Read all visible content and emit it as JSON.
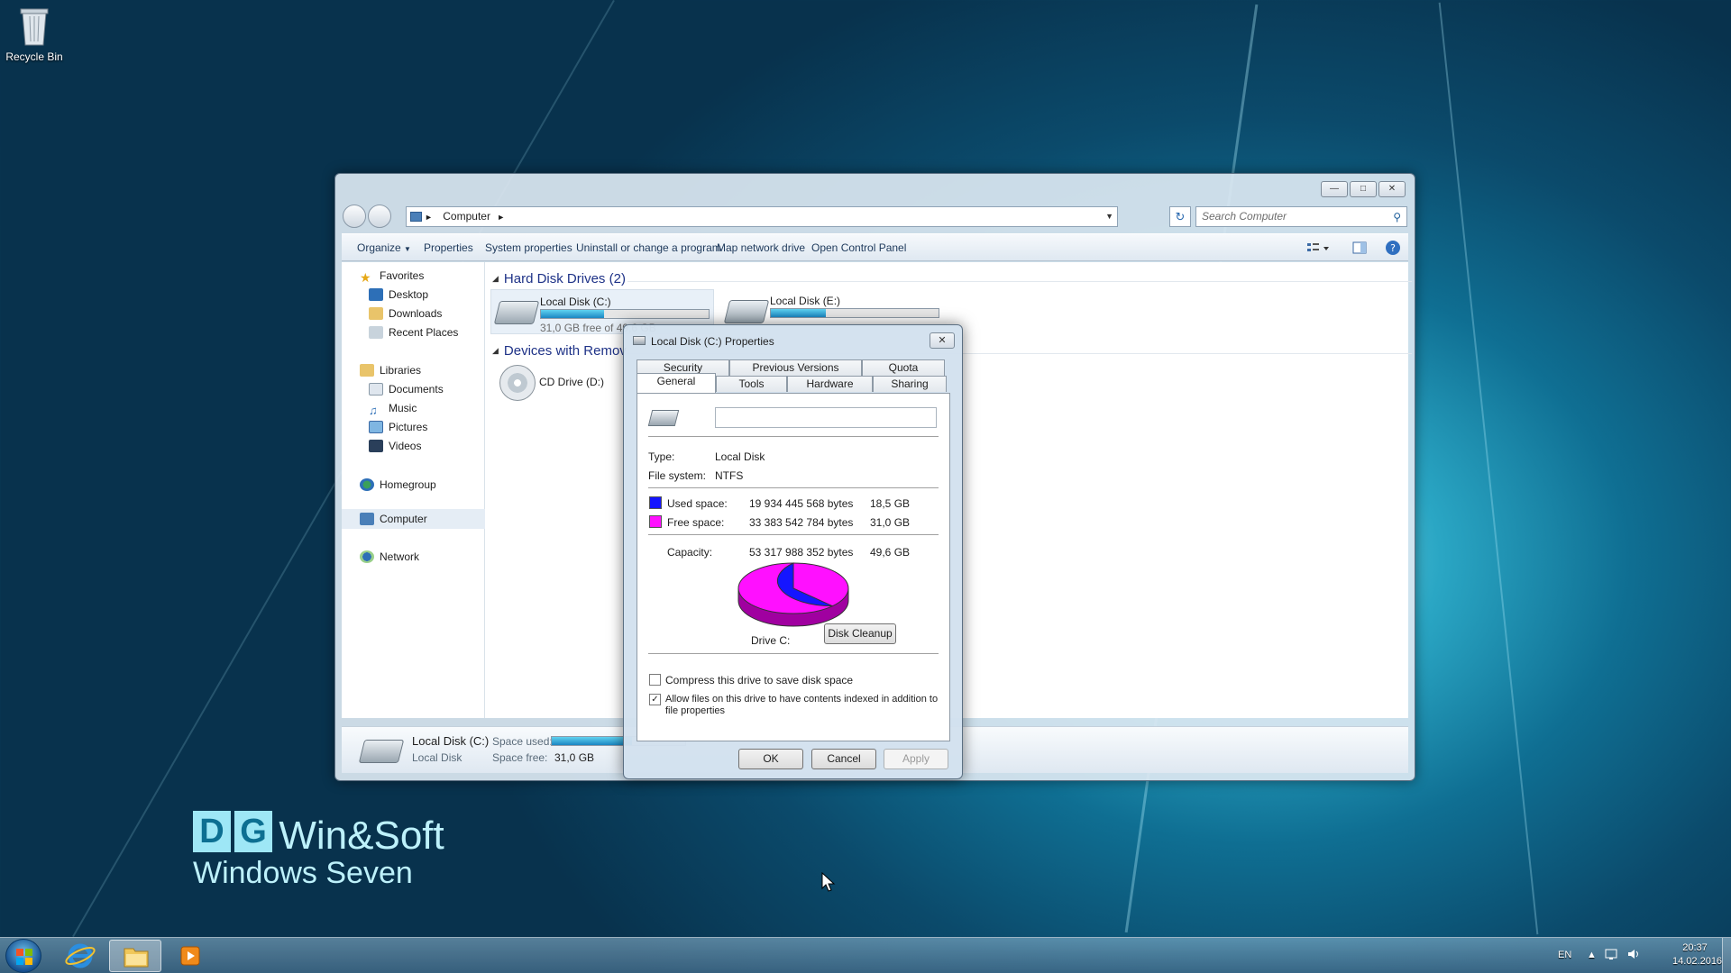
{
  "desktop": {
    "recycle_bin_label": "Recycle Bin",
    "branding": {
      "letters": [
        "D",
        "G"
      ],
      "name": "Win&Soft",
      "subtitle": "Windows Seven"
    }
  },
  "explorer": {
    "address": "Computer",
    "search_placeholder": "Search Computer",
    "toolbar": [
      "Organize",
      "Properties",
      "System properties",
      "Uninstall or change a program",
      "Map network drive",
      "Open Control Panel"
    ],
    "nav": {
      "favorites": "Favorites",
      "favorites_items": [
        "Desktop",
        "Downloads",
        "Recent Places"
      ],
      "libraries": "Libraries",
      "libraries_items": [
        "Documents",
        "Music",
        "Pictures",
        "Videos"
      ],
      "homegroup": "Homegroup",
      "computer": "Computer",
      "network": "Network"
    },
    "groups": {
      "hard_disks": "Hard Disk Drives (2)",
      "removable": "Devices with Remov"
    },
    "drives": [
      {
        "name": "Local Disk (C:)",
        "free_text": "31,0 GB free of 49,6 GB",
        "used_fraction": 0.375
      },
      {
        "name": "Local Disk (E:)",
        "free_text": "",
        "used_fraction": 0.33
      },
      {
        "name": "CD Drive (D:)"
      }
    ],
    "details": {
      "name": "Local Disk (C:)",
      "type": "Local Disk",
      "space_used_label": "Space used:",
      "space_free_label": "Space free:",
      "space_free_value": "31,0 GB",
      "used_fraction": 0.6
    }
  },
  "dialog": {
    "title": "Local Disk (C:) Properties",
    "close": "✕",
    "tabs_row1": [
      "Security",
      "Previous Versions",
      "Quota"
    ],
    "tabs_row2": [
      "General",
      "Tools",
      "Hardware",
      "Sharing"
    ],
    "active_tab": "General",
    "volume_label_value": "",
    "type_label": "Type:",
    "type_value": "Local Disk",
    "fs_label": "File system:",
    "fs_value": "NTFS",
    "used_label": "Used space:",
    "used_bytes": "19 934 445 568 bytes",
    "used_gb": "18,5 GB",
    "free_label": "Free space:",
    "free_bytes": "33 383 542 784 bytes",
    "free_gb": "31,0 GB",
    "capacity_label": "Capacity:",
    "capacity_bytes": "53 317 988 352 bytes",
    "capacity_gb": "49,6 GB",
    "drive_label": "Drive C:",
    "cleanup_button": "Disk Cleanup",
    "compress_label": "Compress this drive to save disk space",
    "compress_checked": false,
    "index_label": "Allow files on this drive to have contents indexed in addition to file properties",
    "index_checked": true,
    "ok": "OK",
    "cancel": "Cancel",
    "apply": "Apply",
    "colors": {
      "used": "#1515ff",
      "free": "#ff10ff"
    },
    "used_fraction": 0.374
  },
  "taskbar": {
    "language": "EN",
    "time": "20:37",
    "date": "14.02.2016"
  }
}
